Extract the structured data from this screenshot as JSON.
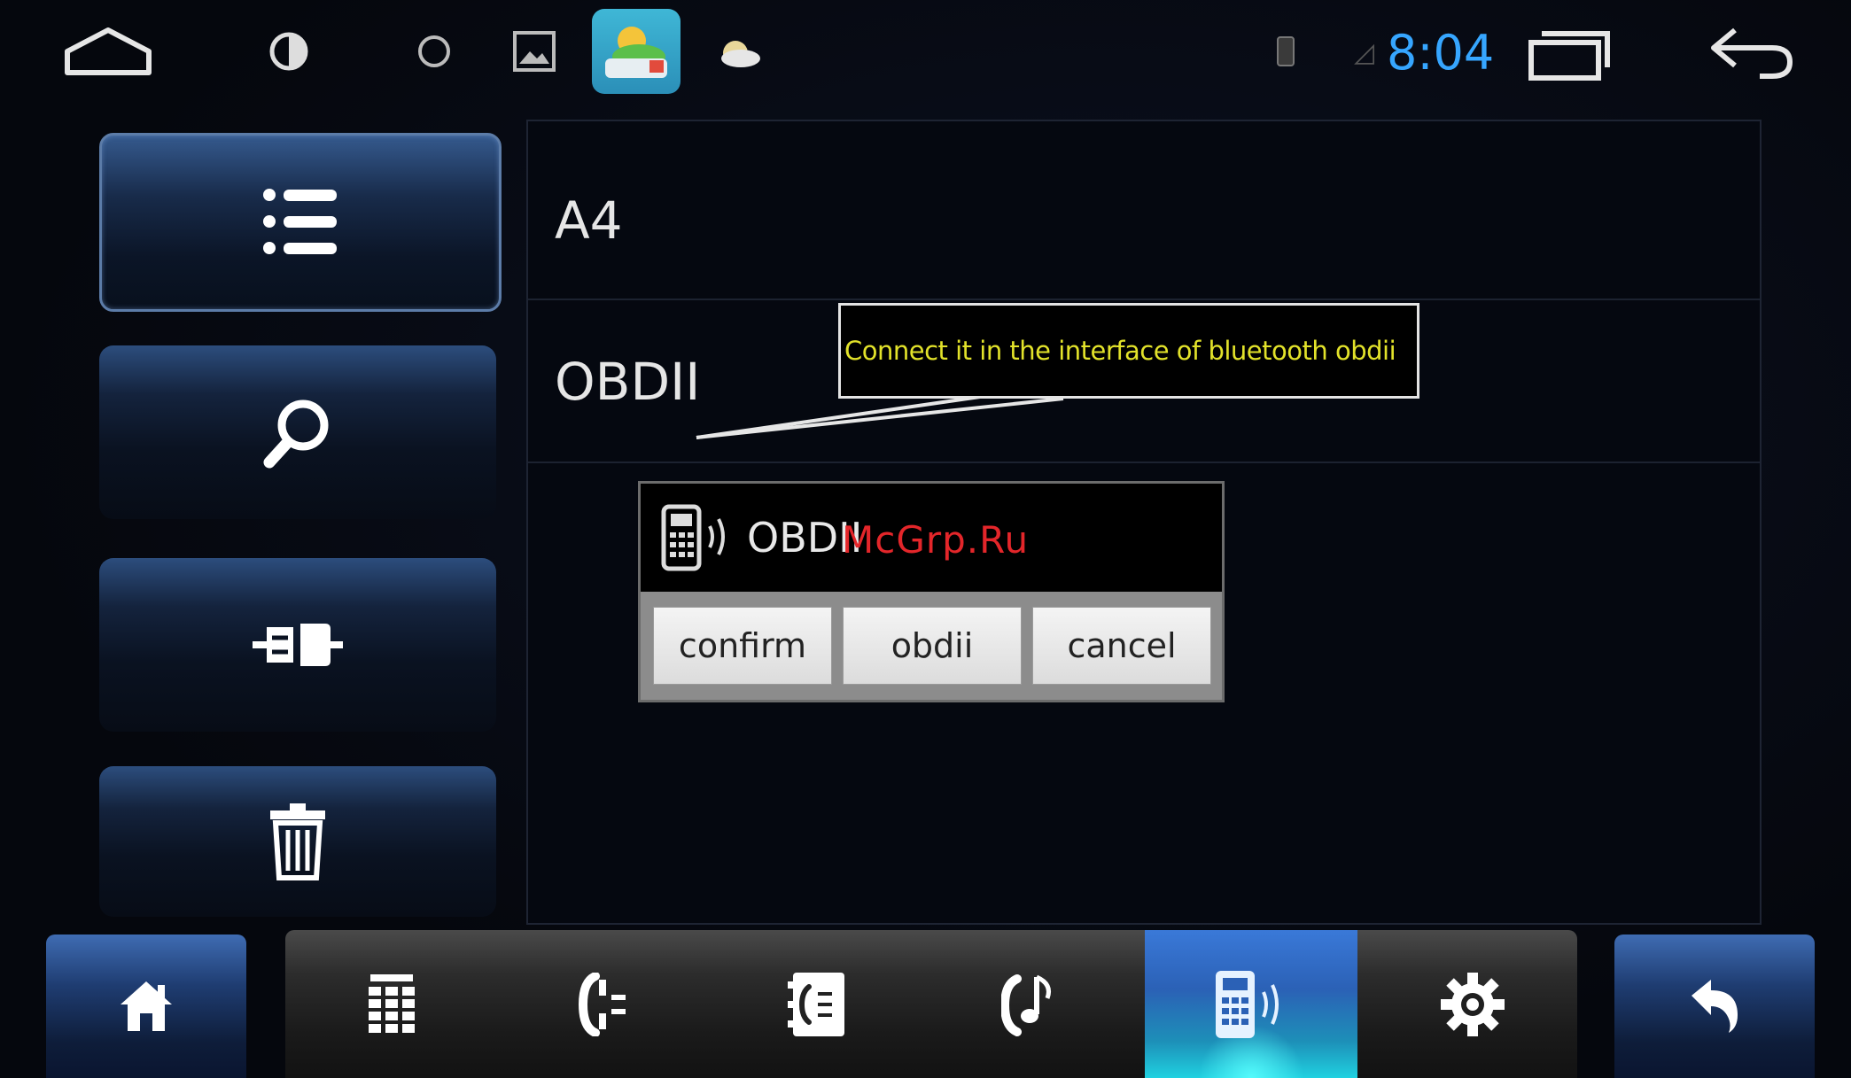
{
  "status_bar": {
    "time": "8:04",
    "icons": [
      "home-outline-icon",
      "brightness-icon",
      "circle-icon",
      "gallery-icon",
      "weather-app-icon",
      "cloud-icon",
      "battery-icon",
      "signal-icon",
      "recents-icon",
      "back-arrow-icon"
    ]
  },
  "sidebar": {
    "items": [
      {
        "name": "list",
        "icon": "list-icon"
      },
      {
        "name": "search",
        "icon": "search-icon"
      },
      {
        "name": "connect",
        "icon": "connect-icon"
      },
      {
        "name": "delete",
        "icon": "trash-icon"
      }
    ]
  },
  "device_list": {
    "items": [
      {
        "label": "A4"
      },
      {
        "label": "OBDII"
      }
    ]
  },
  "callout": {
    "text": "Connect it in the interface of bluetooth obdii"
  },
  "dialog": {
    "title": "OBDII",
    "buttons": {
      "confirm": "confirm",
      "obdii": "obdii",
      "cancel": "cancel"
    }
  },
  "watermark": "McGrp.Ru",
  "bottom_bar": {
    "items": [
      {
        "icon": "home-icon"
      },
      {
        "icon": "dialpad-icon"
      },
      {
        "icon": "call-log-icon"
      },
      {
        "icon": "contacts-icon"
      },
      {
        "icon": "music-icon"
      },
      {
        "icon": "phone-bluetooth-icon",
        "active": true
      },
      {
        "icon": "settings-icon"
      },
      {
        "icon": "back-icon"
      }
    ]
  },
  "colors": {
    "accent_blue": "#36a6ff",
    "callout_text": "#e2e22a",
    "active_tab": "#2b61b6",
    "watermark": "#e3262a"
  }
}
